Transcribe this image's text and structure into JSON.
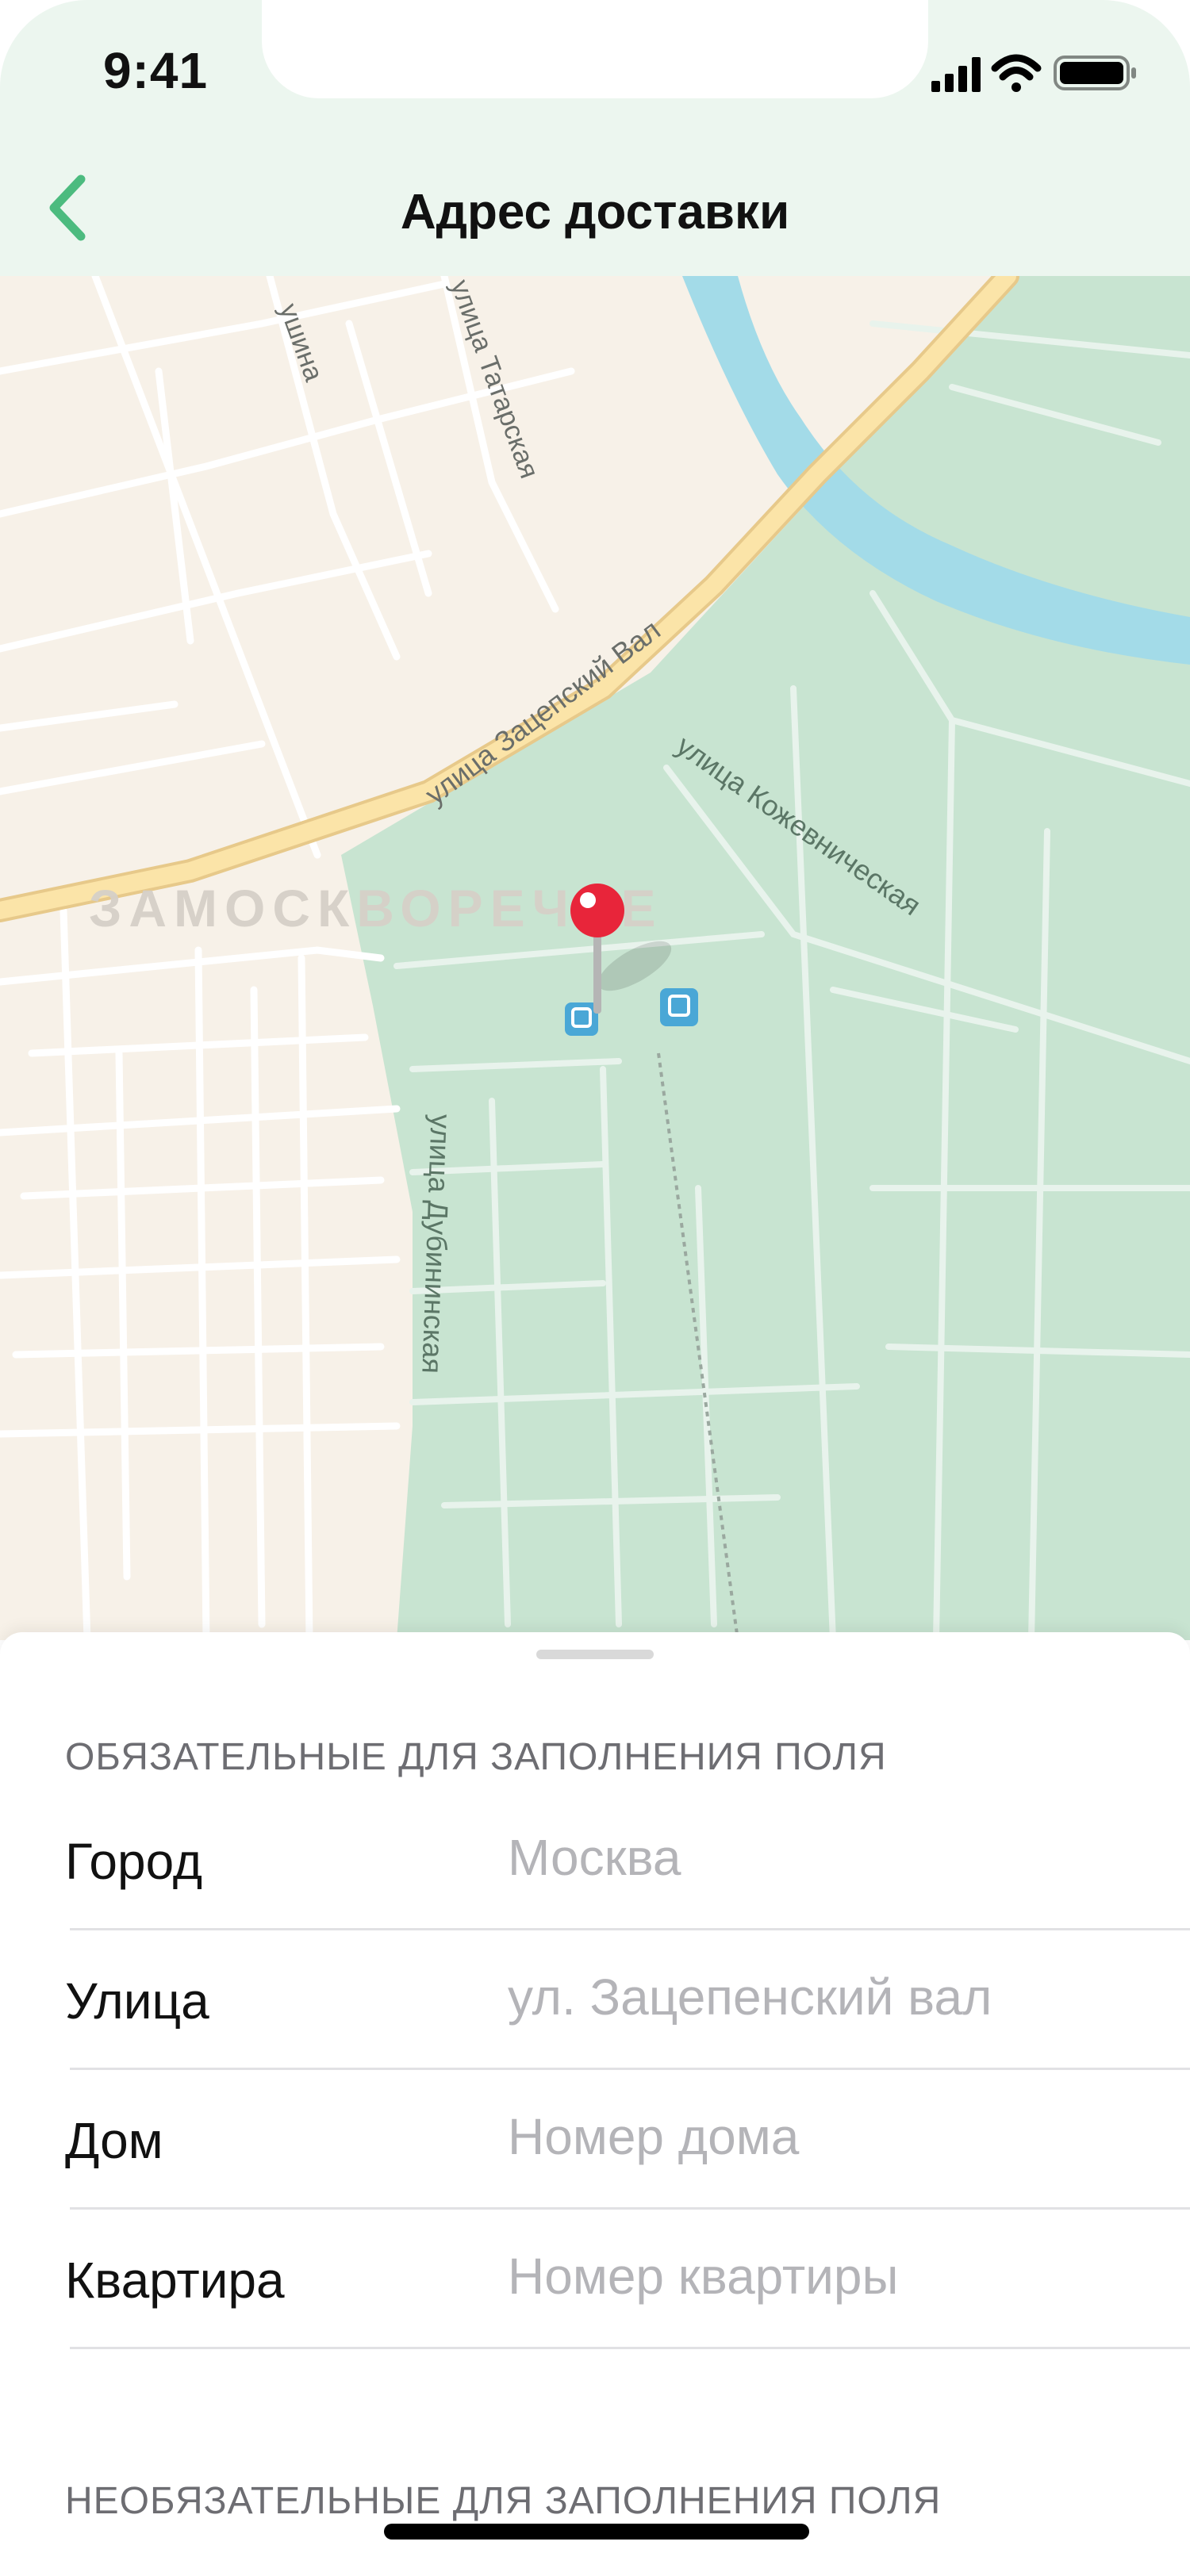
{
  "status_bar": {
    "time": "9:41",
    "icons": [
      "signal-icon",
      "wifi-icon",
      "battery-icon"
    ]
  },
  "nav": {
    "title": "Адрес доставки",
    "back_icon": "chevron-left-icon",
    "accent": "#4cbb7f"
  },
  "map": {
    "district_label": "ЗАМОСКВОРЕЧЬЕ",
    "streets": {
      "a": "улица Татарская",
      "b": "улица Зацепский Вал",
      "c": "улица Кожевническая",
      "d": "улица Дубининская",
      "e": "ушина"
    },
    "colors": {
      "land": "#f7f1e8",
      "park": "#c8e4d1",
      "water": "#a3dbe8",
      "major_road": "#fbe4a8"
    },
    "pin_icon": "location-pin-icon"
  },
  "form": {
    "required_header": "ОБЯЗАТЕЛЬНЫЕ ДЛЯ ЗАПОЛНЕНИЯ ПОЛЯ",
    "optional_header": "НЕОБЯЗАТЕЛЬНЫЕ ДЛЯ ЗАПОЛНЕНИЯ ПОЛЯ",
    "fields": [
      {
        "label": "Город",
        "placeholder": "Москва",
        "value": ""
      },
      {
        "label": "Улица",
        "placeholder": "ул. Зацепенский вал",
        "value": ""
      },
      {
        "label": "Дом",
        "placeholder": "Номер дома",
        "value": ""
      },
      {
        "label": "Квартира",
        "placeholder": "Номер квартиры",
        "value": ""
      }
    ]
  }
}
